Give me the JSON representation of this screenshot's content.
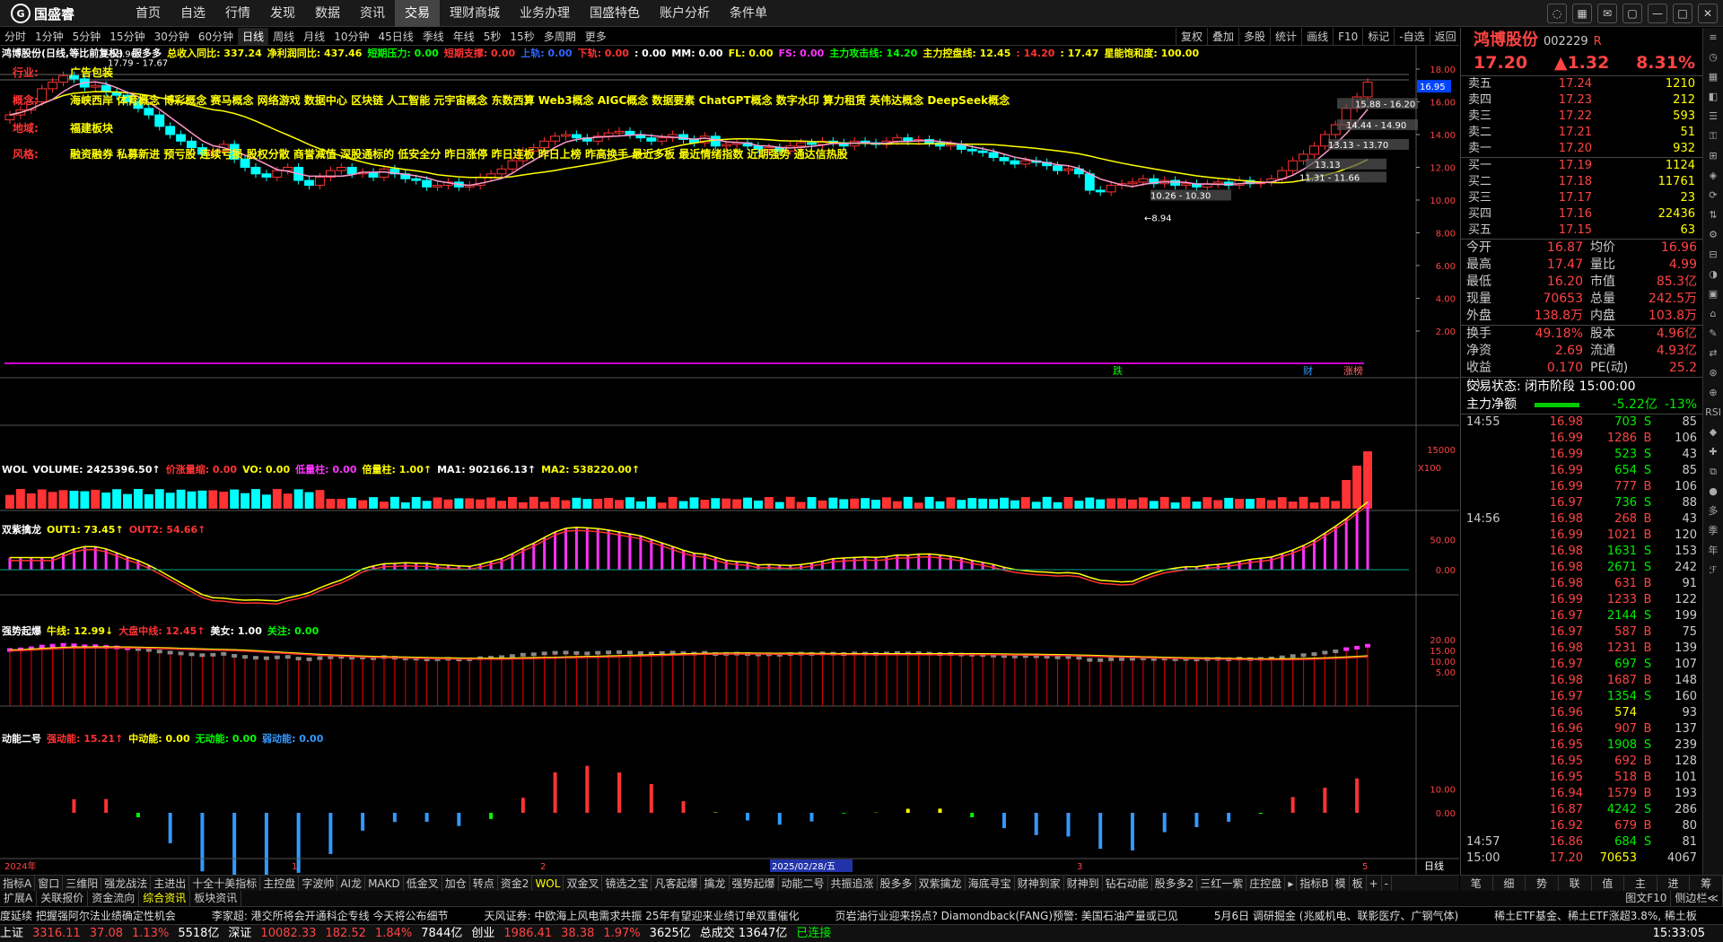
{
  "app": {
    "logo": "国盛睿"
  },
  "menu": [
    "首页",
    "自选",
    "行情",
    "发现",
    "数据",
    "资讯",
    "交易",
    "理财商城",
    "业务办理",
    "国盛特色",
    "账户分析",
    "条件单"
  ],
  "menu_active": 6,
  "period_tabs": [
    "分时",
    "1分钟",
    "5分钟",
    "15分钟",
    "30分钟",
    "60分钟",
    "日线",
    "周线",
    "月线",
    "10分钟",
    "45日线",
    "季线",
    "年线",
    "5秒",
    "15秒",
    "多周期",
    "更多"
  ],
  "period_active": 6,
  "right_tools": [
    "复权",
    "叠加",
    "多股",
    "统计",
    "画线",
    "F10",
    "标记",
    "-自选",
    "返回"
  ],
  "stock": {
    "name": "鸿博股份",
    "code": "002229",
    "flag": "R",
    "price": "17.20",
    "change": "1.32",
    "change_pct": "8.31%"
  },
  "main_legend": "鸿博股份(日线,等比前复权)",
  "main_indicators": [
    {
      "text": "服多多",
      "color": "#ffffff"
    },
    {
      "text": "总收入同比: 337.24",
      "color": "#ffff00"
    },
    {
      "text": "净利润同比: 437.46",
      "color": "#ffff00"
    },
    {
      "text": "短期压力: 0.00",
      "color": "#00ff00"
    },
    {
      "text": "短期支撑: 0.00",
      "color": "#ff3333"
    },
    {
      "text": "上轨: 0.00",
      "color": "#3366ff"
    },
    {
      "text": "下轨: 0.00",
      "color": "#ff3333"
    },
    {
      "text": ": 0.00",
      "color": "#ffffff"
    },
    {
      "text": "MM: 0.00",
      "color": "#ffffff"
    },
    {
      "text": "FL: 0.00",
      "color": "#ffff00"
    },
    {
      "text": "FS: 0.00",
      "color": "#ff33ff"
    },
    {
      "text": "主力攻击线: 14.20",
      "color": "#00ff00"
    },
    {
      "text": "主力控盘线: 12.45",
      "color": "#ffff00"
    },
    {
      "text": ": 14.20",
      "color": "#ff3333"
    },
    {
      "text": ": 17.47",
      "color": "#ffff00"
    },
    {
      "text": "星能饱和度: 100.00",
      "color": "#ffff00"
    }
  ],
  "concepts": {
    "industry_label": "行业:",
    "industry": "广告包装",
    "concept_label": "概念:",
    "concept": "海峡西岸 体育概念 博彩概念 赛马概念 网络游戏 数据中心 区块链 人工智能 元宇宙概念 东数西算 Web3概念 AIGC概念 数据要素 ChatGPT概念 数字水印 算力租赁 英伟达概念 DeepSeek概念",
    "region_label": "地域:",
    "region": "福建板块",
    "style_label": "风格:",
    "style": "融资融券 私募新进 预亏股 连续亏损 股权分散 商誉减值 深股通标的 低安全分 昨日涨停 昨日连板 昨日上榜 昨高换手 最近多板 最近情绪指数 近期强势 通达信热股"
  },
  "price_axis": [
    "18.00",
    "16.00",
    "14.00",
    "12.00",
    "10.00",
    "8.00",
    "6.00",
    "4.00",
    "2.00"
  ],
  "price_tag": "16.95",
  "annotations": {
    "high": "18.96",
    "range_top": "17.79 - 17.67",
    "low_arrow": "8.94",
    "r1": "15.88 - 16.20",
    "r2": "14.44 - 14.90",
    "r3": "13.13 - 13.70",
    "r4": "11.31 - 11.66",
    "r5": "10.26 - 10.30",
    "r6": "13.13"
  },
  "event_marks": [
    {
      "text": "跌",
      "color": "#00ff00"
    },
    {
      "text": "财",
      "color": "#3399ff"
    },
    {
      "text": "涨榜",
      "color": "#ff6666"
    }
  ],
  "vol_legend": [
    {
      "text": "WOL",
      "color": "#ffffff"
    },
    {
      "text": "VOLUME: 2425396.50↑",
      "color": "#ffffff"
    },
    {
      "text": "价涨量缩: 0.00",
      "color": "#ff3333"
    },
    {
      "text": "VO: 0.00",
      "color": "#ffff00"
    },
    {
      "text": "低量柱: 0.00",
      "color": "#ff33ff"
    },
    {
      "text": "倍量柱: 1.00↑",
      "color": "#ffff00"
    },
    {
      "text": "MA1: 902166.13↑",
      "color": "#ffffff"
    },
    {
      "text": "MA2: 538220.00↑",
      "color": "#ffff00"
    }
  ],
  "vol_axis": [
    "15000",
    "X100"
  ],
  "ind2_legend": [
    {
      "text": "双紫擒龙",
      "color": "#ffffff"
    },
    {
      "text": "OUT1: 73.45↑",
      "color": "#ffff00"
    },
    {
      "text": "OUT2: 54.66↑",
      "color": "#ff3333"
    }
  ],
  "ind2_axis": [
    "50.00",
    "0.00"
  ],
  "ind3_legend": [
    {
      "text": "强势起爆",
      "color": "#ffffff"
    },
    {
      "text": "牛线: 12.99↓",
      "color": "#ffff00"
    },
    {
      "text": "大盘中线: 12.45↑",
      "color": "#ff3333"
    },
    {
      "text": "美女: 1.00",
      "color": "#ffffff"
    },
    {
      "text": "关注: 0.00",
      "color": "#00ff00"
    }
  ],
  "ind3_axis": [
    "20.00",
    "15.00",
    "10.00",
    "5.00"
  ],
  "ind4_legend": [
    {
      "text": "动能二号",
      "color": "#ffffff"
    },
    {
      "text": "强动能: 15.21↑",
      "color": "#ff3333"
    },
    {
      "text": "中动能: 0.00",
      "color": "#ffff00"
    },
    {
      "text": "无动能: 0.00",
      "color": "#00ff00"
    },
    {
      "text": "弱动能: 0.00",
      "color": "#3399ff"
    }
  ],
  "ind4_axis": [
    "10.00",
    "0.00"
  ],
  "date_axis": [
    "2024年",
    "1",
    "2",
    "2025/02/28/五",
    "3",
    "4",
    "5"
  ],
  "date_corner": "日线",
  "orderbook_sell": [
    {
      "label": "卖五",
      "price": "17.24",
      "vol": "1210"
    },
    {
      "label": "卖四",
      "price": "17.23",
      "vol": "212"
    },
    {
      "label": "卖三",
      "price": "17.22",
      "vol": "593"
    },
    {
      "label": "卖二",
      "price": "17.21",
      "vol": "51"
    },
    {
      "label": "卖一",
      "price": "17.20",
      "vol": "932"
    }
  ],
  "orderbook_buy": [
    {
      "label": "买一",
      "price": "17.19",
      "vol": "1124"
    },
    {
      "label": "买二",
      "price": "17.18",
      "vol": "11761"
    },
    {
      "label": "买三",
      "price": "17.17",
      "vol": "23"
    },
    {
      "label": "买四",
      "price": "17.16",
      "vol": "22436"
    },
    {
      "label": "买五",
      "price": "17.15",
      "vol": "63"
    }
  ],
  "stats": [
    {
      "k": "今开",
      "v1": "16.87",
      "k2": "均价",
      "v2": "16.96"
    },
    {
      "k": "最高",
      "v1": "17.47",
      "k2": "量比",
      "v2": "4.99"
    },
    {
      "k": "最低",
      "v1": "16.20",
      "k2": "市值",
      "v2": "85.3亿"
    },
    {
      "k": "现量",
      "v1": "70653",
      "k2": "总量",
      "v2": "242.5万"
    },
    {
      "k": "外盘",
      "v1": "138.8万",
      "k2": "内盘",
      "v2": "103.8万"
    }
  ],
  "stats2": [
    {
      "k": "换手",
      "v1": "49.18%",
      "k2": "股本",
      "v2": "4.96亿"
    },
    {
      "k": "净资",
      "v1": "2.69",
      "k2": "流通",
      "v2": "4.93亿"
    },
    {
      "k": "收益(-)",
      "v1": "0.170",
      "k2": "PE(动)",
      "v2": "25.2"
    }
  ],
  "trade_state": "交易状态: 闭市阶段 15:00:00",
  "main_net": {
    "label": "主力净额",
    "value": "-5.22亿",
    "pct": "-13%"
  },
  "ticks": [
    {
      "t": "14:55",
      "p": "16.98",
      "v": "703",
      "s": "S",
      "n": "85"
    },
    {
      "t": "",
      "p": "16.99",
      "v": "1286",
      "s": "B",
      "n": "106"
    },
    {
      "t": "",
      "p": "16.99",
      "v": "523",
      "s": "S",
      "n": "43"
    },
    {
      "t": "",
      "p": "16.99",
      "v": "654",
      "s": "S",
      "n": "85"
    },
    {
      "t": "",
      "p": "16.99",
      "v": "777",
      "s": "B",
      "n": "106"
    },
    {
      "t": "",
      "p": "16.97",
      "v": "736",
      "s": "S",
      "n": "88"
    },
    {
      "t": "14:56",
      "p": "16.98",
      "v": "268",
      "s": "B",
      "n": "43"
    },
    {
      "t": "",
      "p": "16.99",
      "v": "1021",
      "s": "B",
      "n": "120"
    },
    {
      "t": "",
      "p": "16.98",
      "v": "1631",
      "s": "S",
      "n": "153"
    },
    {
      "t": "",
      "p": "16.98",
      "v": "2671",
      "s": "S",
      "n": "242"
    },
    {
      "t": "",
      "p": "16.98",
      "v": "631",
      "s": "B",
      "n": "91"
    },
    {
      "t": "",
      "p": "16.99",
      "v": "1233",
      "s": "B",
      "n": "122"
    },
    {
      "t": "",
      "p": "16.97",
      "v": "2144",
      "s": "S",
      "n": "199"
    },
    {
      "t": "",
      "p": "16.97",
      "v": "587",
      "s": "B",
      "n": "75"
    },
    {
      "t": "",
      "p": "16.98",
      "v": "1231",
      "s": "B",
      "n": "139"
    },
    {
      "t": "",
      "p": "16.97",
      "v": "697",
      "s": "S",
      "n": "107"
    },
    {
      "t": "",
      "p": "16.98",
      "v": "1687",
      "s": "B",
      "n": "148"
    },
    {
      "t": "",
      "p": "16.97",
      "v": "1354",
      "s": "S",
      "n": "160"
    },
    {
      "t": "",
      "p": "16.96",
      "v": "574",
      "s": "",
      "n": "93"
    },
    {
      "t": "",
      "p": "16.96",
      "v": "907",
      "s": "B",
      "n": "137"
    },
    {
      "t": "",
      "p": "16.95",
      "v": "1908",
      "s": "S",
      "n": "239"
    },
    {
      "t": "",
      "p": "16.95",
      "v": "692",
      "s": "B",
      "n": "128"
    },
    {
      "t": "",
      "p": "16.95",
      "v": "518",
      "s": "B",
      "n": "101"
    },
    {
      "t": "",
      "p": "16.94",
      "v": "1579",
      "s": "B",
      "n": "193"
    },
    {
      "t": "",
      "p": "16.87",
      "v": "4242",
      "s": "S",
      "n": "286"
    },
    {
      "t": "",
      "p": "16.92",
      "v": "679",
      "s": "B",
      "n": "80"
    },
    {
      "t": "14:57",
      "p": "16.86",
      "v": "684",
      "s": "S",
      "n": "81"
    },
    {
      "t": "15:00",
      "p": "17.20",
      "v": "70653",
      "s": "",
      "n": "4067"
    }
  ],
  "side_icons": [
    "笔",
    "细",
    "势",
    "联",
    "值",
    "主",
    "进",
    "筹"
  ],
  "right_strip": [
    "≡",
    "◷",
    "▦",
    "◧",
    "☰",
    "⚿",
    "⊞",
    "◈",
    "⟳",
    "⇅",
    "⚙",
    "⊟",
    "◑",
    "▣",
    "⌂",
    "✎",
    "⇄",
    "⊛",
    "⊕",
    "RSI",
    "◆",
    "✚",
    "⧉",
    "●",
    "多",
    "季",
    "年",
    "ℱ"
  ],
  "indicator_tabs": [
    "指标A",
    "窗口",
    "三维阳",
    "强龙战法",
    "主进出",
    "十全十美指标",
    "主控盘",
    "字波帅",
    "AI龙",
    "MAKD",
    "低金叉",
    "加仓",
    "转点",
    "资金2",
    "WOL",
    "双金叉",
    "镜选之宝",
    "凡客起爆",
    "擒龙",
    "强势起爆",
    "动能二号",
    "共振追涨",
    "股多多",
    "双紫擒龙",
    "海底寻宝",
    "财神到家",
    "财神到",
    "钻石动能",
    "股多多2",
    "三红一紫",
    "庄控盘",
    "▸",
    "指标B",
    "模",
    "板",
    "+",
    "-"
  ],
  "indicator_tab_sel": 14,
  "sub_tabs": [
    "扩展A",
    "关联报价",
    "资金流向",
    "综合资讯",
    "板块资讯"
  ],
  "sub_tab_sel": 3,
  "news": [
    "度延续 把握强阿尔法业绩确定性机会",
    "李家超: 港交所将会开通科企专线 今天将公布细节",
    "天风证券: 中欧海上风电需求共振 25年有望迎来业绩订单双重催化",
    "页岩油行业迎来拐点? Diamondback(FANG)预警: 美国石油产量或已见",
    "5月6日 调研掘金 (兆威机电、联影医疗、广钢气体)",
    "稀土ETF基金、稀土ETF涨超3.8%, 稀土板"
  ],
  "status": [
    {
      "label": "上证",
      "v": "3316.11",
      "c": "37.08",
      "p": "1.13%",
      "a": "5518亿"
    },
    {
      "label": "深证",
      "v": "10082.33",
      "c": "182.52",
      "p": "1.84%",
      "a": "7844亿"
    },
    {
      "label": "创业",
      "v": "1986.41",
      "c": "38.38",
      "p": "1.97%",
      "a": "3625亿"
    }
  ],
  "status_total": "总成交 13647亿",
  "status_conn": "已连接",
  "status_time": "15:33:05",
  "right_panel_tabs": [
    "图文F10",
    "侧边栏≪"
  ],
  "chart_data": {
    "type": "candlestick",
    "closes": [
      15.2,
      15.5,
      16.0,
      16.8,
      17.2,
      17.6,
      17.4,
      16.9,
      17.0,
      16.6,
      16.4,
      16.0,
      15.6,
      15.2,
      14.5,
      14.0,
      13.6,
      13.2,
      12.8,
      13.0,
      13.4,
      12.5,
      12.0,
      11.6,
      11.4,
      11.8,
      12.0,
      11.2,
      10.9,
      11.4,
      11.8,
      12.0,
      11.6,
      11.7,
      11.4,
      11.9,
      11.6,
      11.3,
      11.2,
      10.8,
      10.9,
      11.1,
      10.8,
      10.9,
      11.4,
      11.6,
      11.9,
      12.4,
      13.0,
      13.2,
      13.6,
      13.9,
      14.0,
      13.8,
      13.6,
      13.9,
      14.1,
      14.2,
      14.0,
      13.8,
      13.6,
      13.8,
      14.0,
      13.7,
      13.5,
      13.9,
      13.3,
      13.4,
      13.5,
      13.3,
      13.1,
      13.2,
      13.0,
      13.3,
      13.5,
      13.4,
      13.6,
      13.5,
      13.3,
      13.6,
      13.5,
      13.4,
      13.6,
      13.8,
      13.6,
      13.7,
      13.5,
      13.3,
      13.4,
      13.1,
      13.0,
      12.9,
      12.6,
      12.4,
      12.2,
      12.4,
      12.3,
      12.1,
      11.8,
      11.9,
      11.6,
      10.6,
      10.5,
      10.9,
      11.0,
      11.1,
      11.3,
      11.0,
      11.2,
      10.9,
      11.0,
      10.8,
      11.0,
      11.1,
      10.9,
      11.2,
      11.0,
      11.1,
      11.3,
      11.8,
      12.4,
      12.8,
      13.3,
      14.0,
      14.6,
      15.6,
      16.3,
      17.2
    ]
  }
}
